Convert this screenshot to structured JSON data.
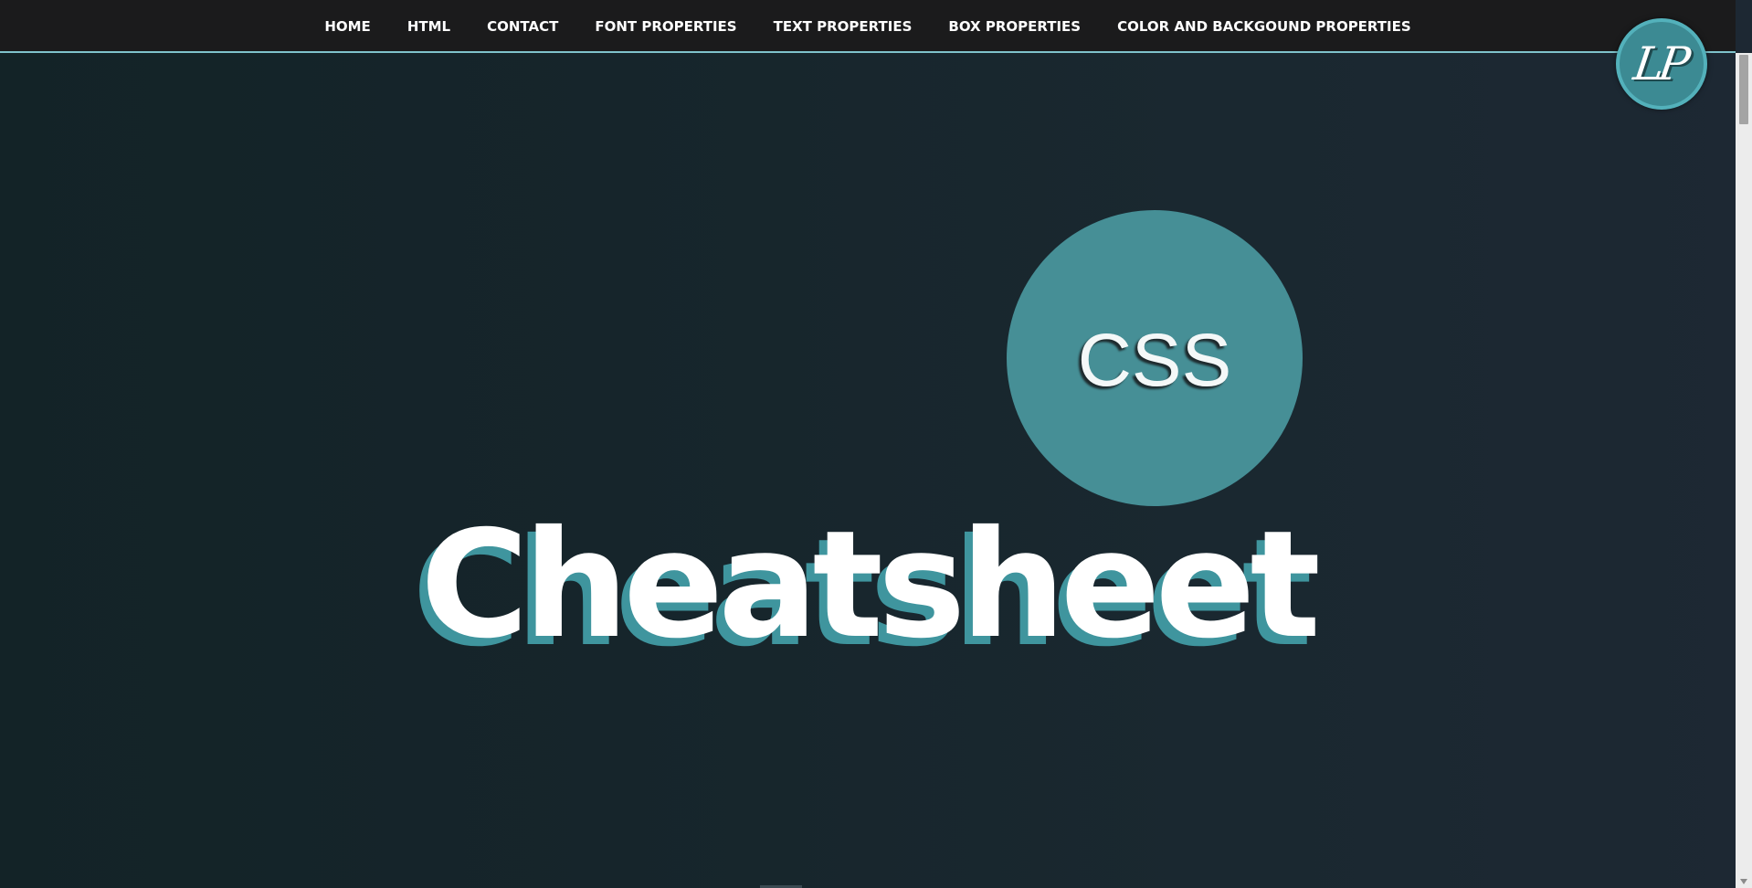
{
  "nav": {
    "items": [
      {
        "label": "HOME"
      },
      {
        "label": "HTML"
      },
      {
        "label": "CONTACT"
      },
      {
        "label": "FONT PROPERTIES"
      },
      {
        "label": "TEXT PROPERTIES"
      },
      {
        "label": "BOX PROPERTIES"
      },
      {
        "label": "COLOR AND BACKGOUND PROPERTIES"
      }
    ]
  },
  "logo": {
    "text": "LP",
    "icon": "lp-logo"
  },
  "hero": {
    "badge_text": "CSS",
    "title": "Cheatsheet"
  },
  "colors": {
    "accent": "#468f96",
    "nav_background": "#1b1b1c",
    "nav_border": "#7fc3cc",
    "page_background": "#16252b"
  }
}
